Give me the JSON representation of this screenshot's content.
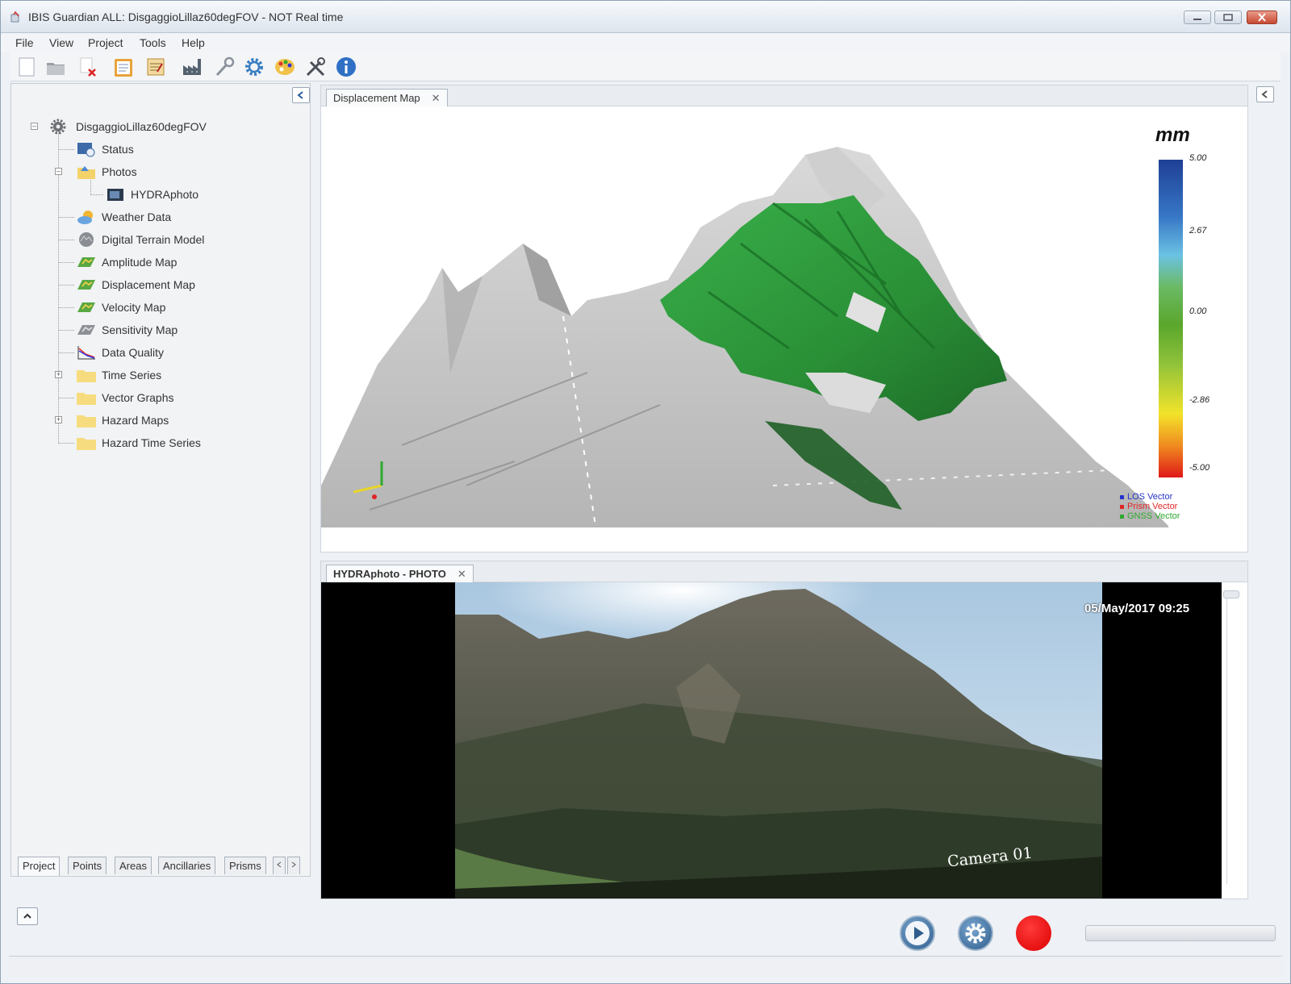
{
  "window": {
    "title": "IBIS Guardian ALL: DisgaggioLillaz60degFOV - NOT Real time"
  },
  "menu": [
    "File",
    "View",
    "Project",
    "Tools",
    "Help"
  ],
  "toolbar": {
    "icons": [
      "new-file-icon",
      "open-folder-icon",
      "close-project-icon",
      "clipboard-icon",
      "notes-icon",
      "factory-icon",
      "probe-icon",
      "gear-icon",
      "palette-icon",
      "tools-icon",
      "info-icon"
    ]
  },
  "tree": {
    "root": "DisgaggioLillaz60degFOV",
    "items": [
      {
        "label": "Status",
        "icon": "status-icon"
      },
      {
        "label": "Photos",
        "icon": "photos-folder-icon"
      },
      {
        "label": "HYDRAphoto",
        "icon": "camera-icon"
      },
      {
        "label": "Weather Data",
        "icon": "weather-icon"
      },
      {
        "label": "Digital Terrain Model",
        "icon": "terrain-icon"
      },
      {
        "label": "Amplitude Map",
        "icon": "map-icon"
      },
      {
        "label": "Displacement Map",
        "icon": "map-icon"
      },
      {
        "label": "Velocity Map",
        "icon": "map-icon"
      },
      {
        "label": "Sensitivity Map",
        "icon": "map-gray-icon"
      },
      {
        "label": "Data Quality",
        "icon": "chart-icon"
      },
      {
        "label": "Time Series",
        "icon": "folder-icon"
      },
      {
        "label": "Vector Graphs",
        "icon": "folder-icon"
      },
      {
        "label": "Hazard Maps",
        "icon": "folder-icon"
      },
      {
        "label": "Hazard Time Series",
        "icon": "folder-icon"
      }
    ]
  },
  "left_tabs": [
    "Project",
    "Points",
    "Areas",
    "Ancillaries",
    "Prisms"
  ],
  "displacement_panel": {
    "tab": "Displacement Map",
    "unit": "mm",
    "colorbar_ticks": [
      "5.00",
      "2.67",
      "0.00",
      "-2.86",
      "-5.00"
    ],
    "vector_legend": [
      {
        "label": "LOS Vector",
        "color": "#2633c9"
      },
      {
        "label": "Prism Vector",
        "color": "#e02525"
      },
      {
        "label": "GNSS Vector",
        "color": "#2ea82e"
      }
    ]
  },
  "photo_panel": {
    "tab": "HYDRAphoto - PHOTO",
    "timestamp": "05/May/2017 09:25",
    "camera_label": "Camera 01"
  },
  "controls": {
    "play": "play-icon",
    "settings": "gear-icon",
    "record": "record-icon"
  }
}
